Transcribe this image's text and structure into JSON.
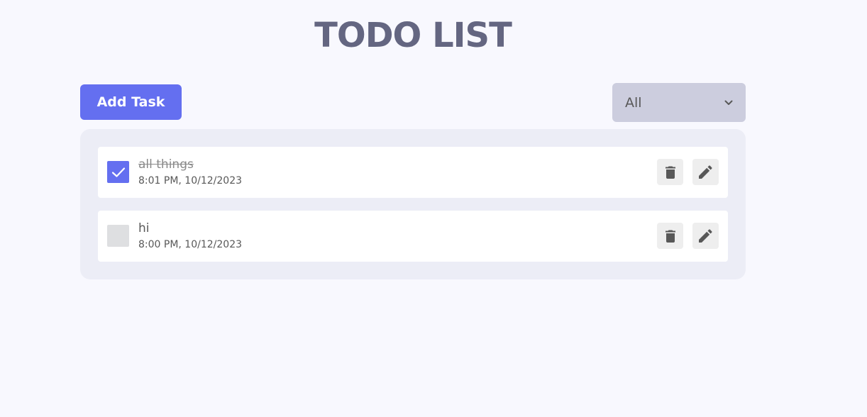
{
  "header": {
    "title": "TODO LIST"
  },
  "toolbar": {
    "add_label": "Add Task",
    "filter": {
      "selected": "All",
      "icon": "chevron-down-icon"
    }
  },
  "todos": [
    {
      "title": "all things",
      "time": "8:01 PM, 10/12/2023",
      "completed": true
    },
    {
      "title": "hi",
      "time": "8:00 PM, 10/12/2023",
      "completed": false
    }
  ],
  "icons": {
    "check": "check-icon",
    "delete": "trash-icon",
    "edit": "pencil-icon"
  },
  "colors": {
    "accent": "#646ff0",
    "title": "#646681",
    "panel": "#ecedf6",
    "filter_bg": "#cccdde",
    "icon": "#585858"
  }
}
